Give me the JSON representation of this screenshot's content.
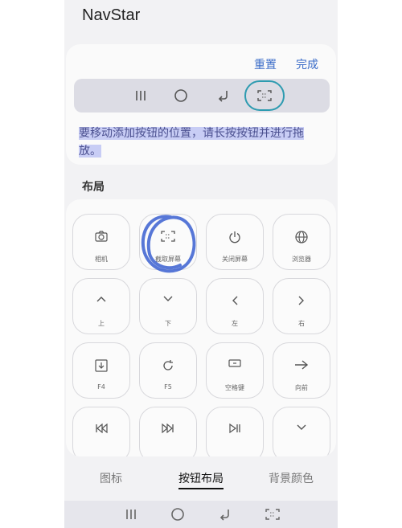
{
  "app": {
    "title": "NavStar"
  },
  "header_actions": {
    "reset": "重置",
    "done": "完成"
  },
  "nav_preview": {
    "icons": [
      "recents-icon",
      "home-icon",
      "back-icon",
      "screenshot-icon"
    ],
    "highlight_color": "#2d9bb0"
  },
  "hint": "要移动添加按钮的位置，请长按按钮并进行拖放。",
  "section": {
    "title": "布局"
  },
  "buttons": [
    {
      "icon": "camera-icon",
      "label": "相机"
    },
    {
      "icon": "screenshot-icon",
      "label": "截取屏幕"
    },
    {
      "icon": "power-icon",
      "label": "关闭屏幕"
    },
    {
      "icon": "globe-icon",
      "label": "浏览器"
    },
    {
      "icon": "chevron-up-icon",
      "label": "上"
    },
    {
      "icon": "chevron-down-icon",
      "label": "下"
    },
    {
      "icon": "chevron-left-icon",
      "label": "左"
    },
    {
      "icon": "chevron-right-icon",
      "label": "右"
    },
    {
      "icon": "download-icon",
      "label": "F4"
    },
    {
      "icon": "refresh-icon",
      "label": "F5"
    },
    {
      "icon": "spacebar-icon",
      "label": "空格键"
    },
    {
      "icon": "arrow-right-icon",
      "label": "向前"
    },
    {
      "icon": "skip-back-icon",
      "label": ""
    },
    {
      "icon": "skip-forward-icon",
      "label": ""
    },
    {
      "icon": "play-pause-icon",
      "label": ""
    },
    {
      "icon": "chevron-down-icon",
      "label": ""
    }
  ],
  "tabs": {
    "items": [
      "图标",
      "按钮布局",
      "背景颜色"
    ],
    "active": "按钮布局"
  },
  "colors": {
    "accent": "#3b6cc8",
    "highlight": "#c8cdf5",
    "scribble": "#3a5fd0"
  }
}
